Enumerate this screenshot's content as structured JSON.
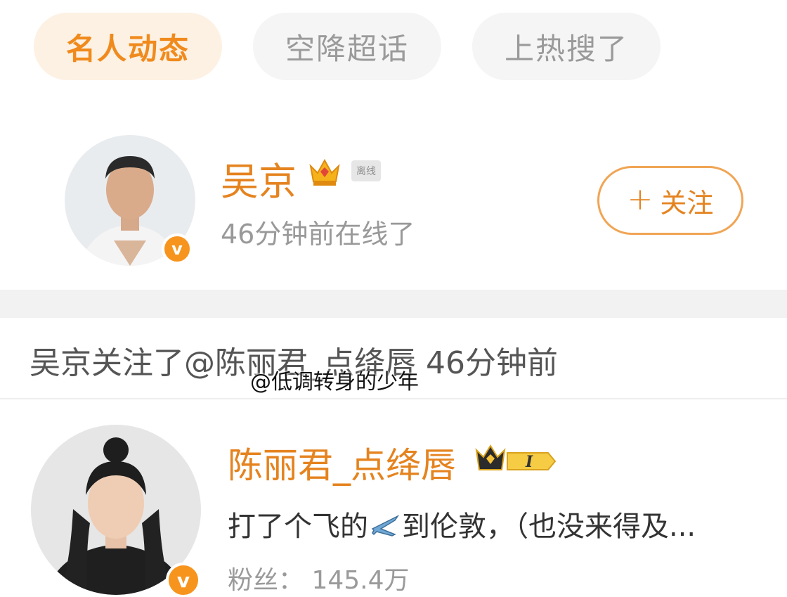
{
  "tabs": [
    {
      "label": "名人动态",
      "active": true
    },
    {
      "label": "空降超话",
      "active": false
    },
    {
      "label": "上热搜了",
      "active": false
    }
  ],
  "user1": {
    "name": "吴京",
    "status_badge": "离线",
    "last_online": "46分钟前在线了",
    "follow_label": "关注",
    "follow_plus": "+",
    "verified_mark": "v"
  },
  "activity": {
    "text": "吴京关注了@陈丽君_点绛唇 46分钟前"
  },
  "watermark": "@低调转身的少年",
  "user2": {
    "name": "陈丽君_点绛唇",
    "vip_level": "I",
    "post_before": "打了个飞的",
    "post_emoji": "airplane-icon",
    "post_after": "到伦敦，（也没来得及...",
    "fans": "粉丝：  145.4万",
    "verified_mark": "v"
  },
  "colors": {
    "accent": "#f08a1c",
    "tab_active_bg": "#fdf1e3",
    "tab_bg": "#f5f5f5",
    "verified": "#f7941d"
  }
}
